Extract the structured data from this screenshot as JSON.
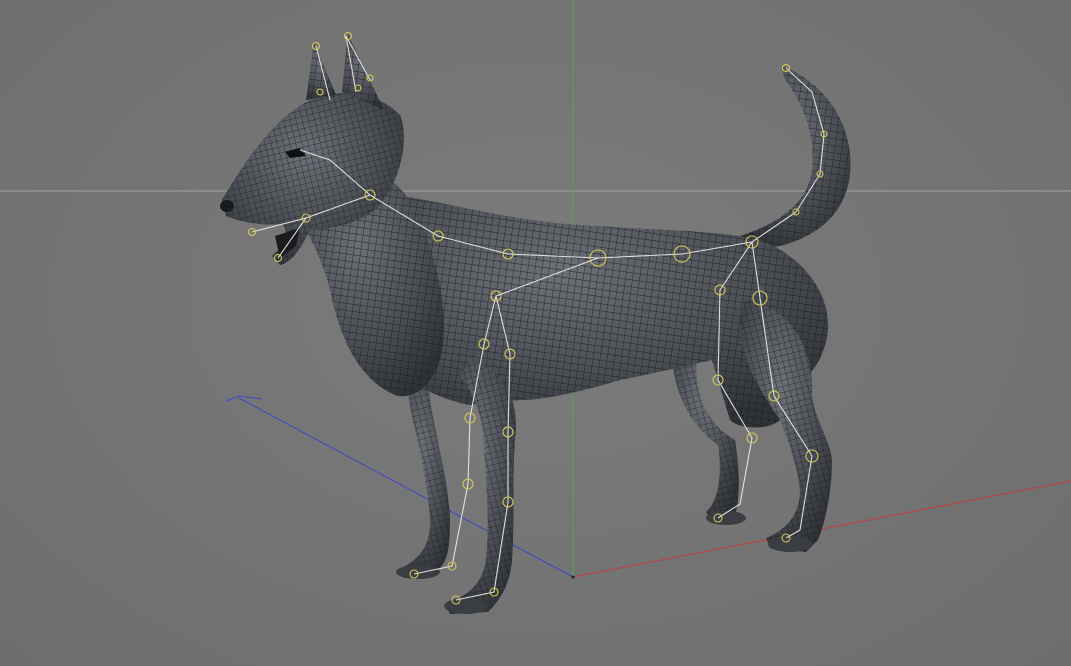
{
  "viewport": {
    "label": "",
    "background": "#757575",
    "horizon_line_color": "#a4a4a4",
    "axes": {
      "x": "#c83a3a",
      "y": "#3bb34a",
      "z": "#3a48c8"
    }
  },
  "model": {
    "subject": "wireframe-dog-mesh",
    "mesh_color": "#4f5358",
    "wire_color": "#1a1c1f",
    "bone_color": "#f2f2f2",
    "joint_color": "#d6c85a"
  }
}
